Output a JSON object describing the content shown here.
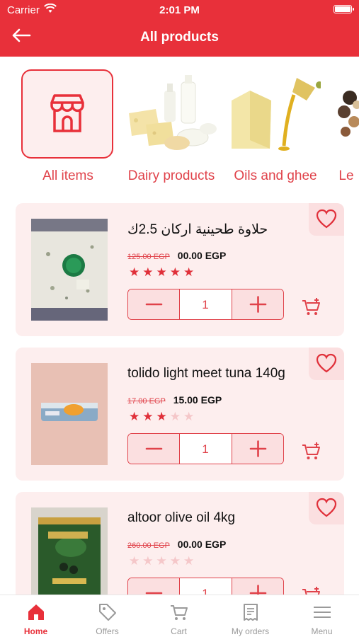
{
  "status_bar": {
    "carrier": "Carrier",
    "time": "2:01 PM"
  },
  "header": {
    "title": "All products"
  },
  "categories": [
    {
      "label": "All items",
      "icon": "store-icon"
    },
    {
      "label": "Dairy products"
    },
    {
      "label": "Oils and ghee"
    },
    {
      "label": "Le"
    }
  ],
  "products": [
    {
      "name": "حلاوة طحينية اركان 2.5ك",
      "old_price": "125.00 EGP",
      "price": "00.00 EGP",
      "rating": 5,
      "quantity": "1"
    },
    {
      "name": "tolido light meet tuna 140g",
      "old_price": "17.00 EGP",
      "price": "15.00 EGP",
      "rating": 3,
      "quantity": "1"
    },
    {
      "name": "altoor olive oil 4kg",
      "old_price": "260.00 EGP",
      "price": "00.00 EGP",
      "rating": 0,
      "quantity": "1"
    }
  ],
  "tabbar": [
    {
      "label": "Home",
      "icon": "home-icon",
      "active": true
    },
    {
      "label": "Offers",
      "icon": "tag-icon"
    },
    {
      "label": "Cart",
      "icon": "cart-icon"
    },
    {
      "label": "My orders",
      "icon": "receipt-icon"
    },
    {
      "label": "Menu",
      "icon": "menu-icon"
    }
  ],
  "colors": {
    "brand": "#e8303a",
    "card_bg": "#fdeeee",
    "accent_soft": "#fbdfe0"
  }
}
